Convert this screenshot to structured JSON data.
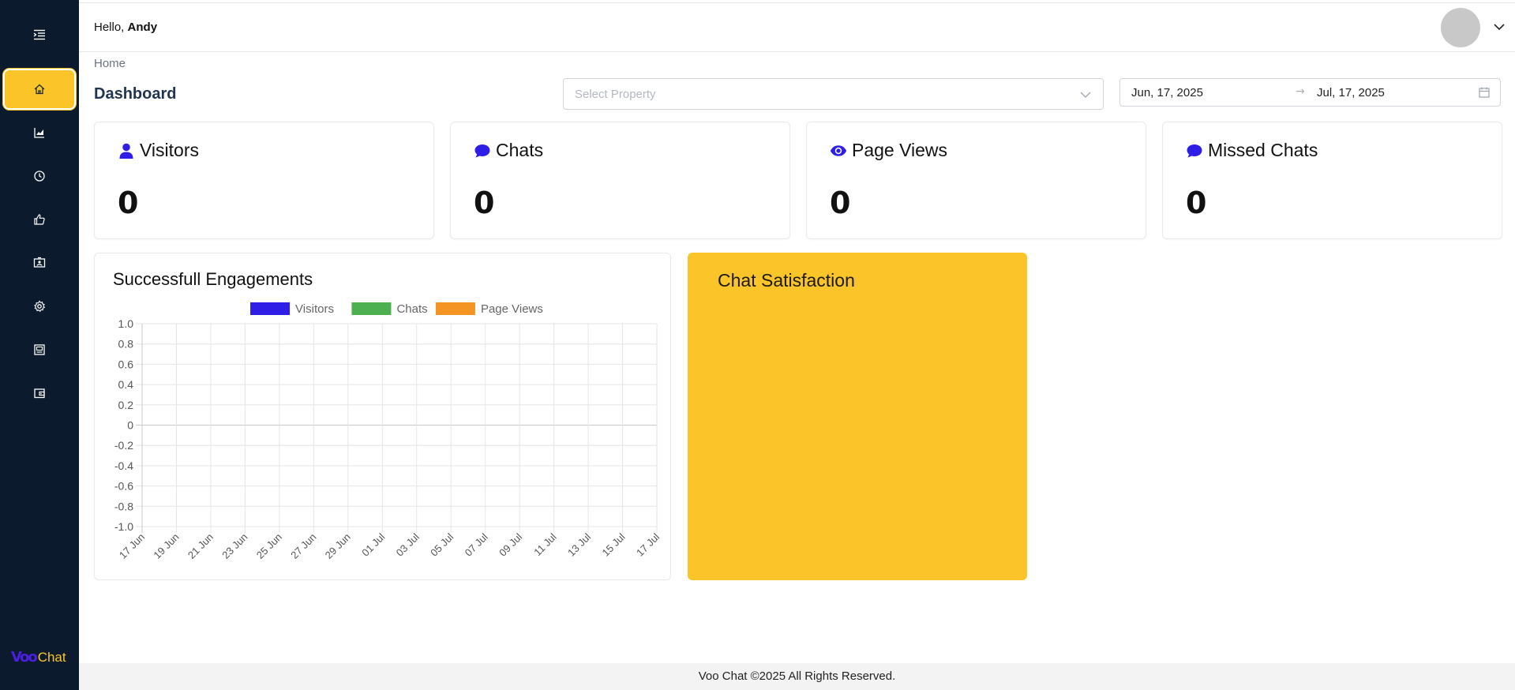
{
  "header": {
    "greeting": "Hello,",
    "user_name": "Andy"
  },
  "breadcrumb": "Home",
  "page_title": "Dashboard",
  "filters": {
    "property_placeholder": "Select Property",
    "date_start": "Jun, 17, 2025",
    "date_separator": "→",
    "date_end": "Jul, 17, 2025"
  },
  "sidebar": {
    "items": [
      {
        "icon": "home-icon",
        "active": true
      },
      {
        "icon": "chart-icon",
        "active": false
      },
      {
        "icon": "clock-icon",
        "active": false
      },
      {
        "icon": "thumbs-up-icon",
        "active": false
      },
      {
        "icon": "contact-card-icon",
        "active": false
      },
      {
        "icon": "gear-icon",
        "active": false
      },
      {
        "icon": "robot-icon",
        "active": false
      },
      {
        "icon": "wallet-icon",
        "active": false
      }
    ],
    "logo_mark": "Voo",
    "logo_word": "Chat"
  },
  "stats": [
    {
      "label": "Visitors",
      "value": "0",
      "icon": "user-icon"
    },
    {
      "label": "Chats",
      "value": "0",
      "icon": "chat-bubble-icon"
    },
    {
      "label": "Page Views",
      "value": "0",
      "icon": "eye-icon"
    },
    {
      "label": "Missed Chats",
      "value": "0",
      "icon": "chat-bubble-icon"
    }
  ],
  "chart_card_title": "Successfull Engagements",
  "chart_data": {
    "type": "line",
    "title": "",
    "xlabel": "",
    "ylabel": "",
    "ylim": [
      -1.0,
      1.0
    ],
    "yticks": [
      "1.0",
      "0.8",
      "0.6",
      "0.4",
      "0.2",
      "0",
      "-0.2",
      "-0.4",
      "-0.6",
      "-0.8",
      "-1.0"
    ],
    "x": [
      "17 Jun",
      "19 Jun",
      "21 Jun",
      "23 Jun",
      "25 Jun",
      "27 Jun",
      "29 Jun",
      "01 Jul",
      "03 Jul",
      "05 Jul",
      "07 Jul",
      "09 Jul",
      "11 Jul",
      "13 Jul",
      "15 Jul",
      "17 Jul"
    ],
    "series": [
      {
        "name": "Visitors",
        "color": "#2f1ee6",
        "values": []
      },
      {
        "name": "Chats",
        "color": "#4caf50",
        "values": []
      },
      {
        "name": "Page Views",
        "color": "#f39423",
        "values": []
      }
    ],
    "grid": true,
    "legend": "top"
  },
  "satisfaction_title": "Chat Satisfaction",
  "footer_text": "Voo Chat ©2025 All Rights Reserved.",
  "colors": {
    "sidebar_bg": "#0b1a2c",
    "accent_yellow": "#fbc52a",
    "icon_blue": "#2f1ee6"
  }
}
